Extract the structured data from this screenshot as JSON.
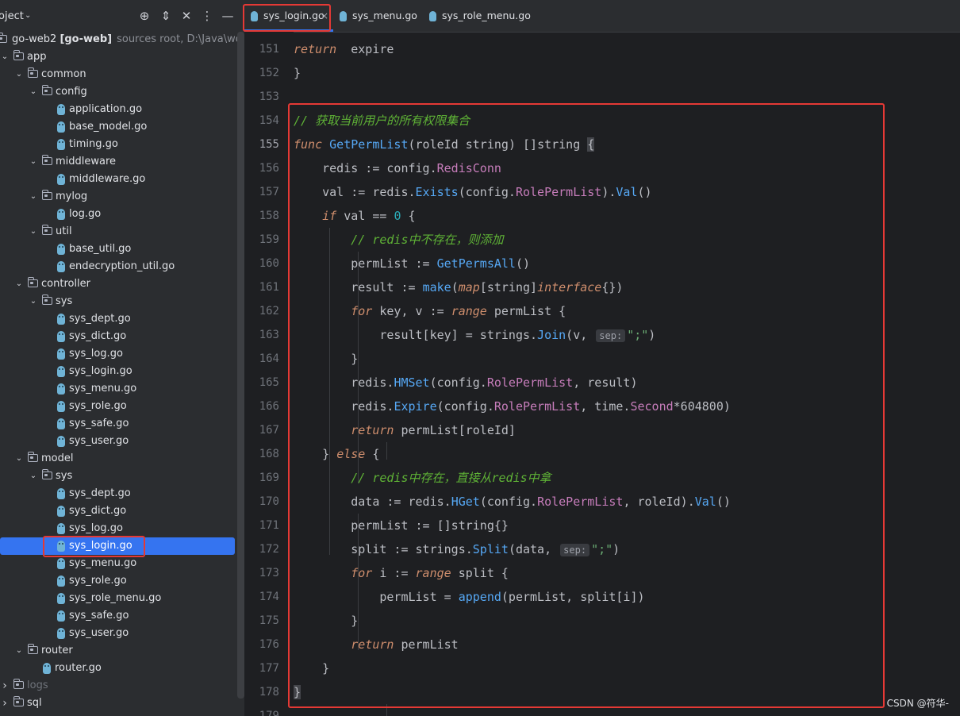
{
  "project": {
    "title": "oject",
    "root_label": "go-web2 [go-web]",
    "root_sub": "sources root,  D:\\Java\\wor",
    "tree": [
      {
        "label": "go-web2 [go-web]",
        "kind": "root",
        "depth": 0
      },
      {
        "label": "app",
        "kind": "folder",
        "depth": 0
      },
      {
        "label": "common",
        "kind": "folder",
        "depth": 1
      },
      {
        "label": "config",
        "kind": "folder",
        "depth": 2
      },
      {
        "label": "application.go",
        "kind": "go",
        "depth": 3
      },
      {
        "label": "base_model.go",
        "kind": "go",
        "depth": 3
      },
      {
        "label": "timing.go",
        "kind": "go",
        "depth": 3
      },
      {
        "label": "middleware",
        "kind": "folder",
        "depth": 2
      },
      {
        "label": "middleware.go",
        "kind": "go",
        "depth": 3
      },
      {
        "label": "mylog",
        "kind": "folder",
        "depth": 2
      },
      {
        "label": "log.go",
        "kind": "go",
        "depth": 3
      },
      {
        "label": "util",
        "kind": "folder",
        "depth": 2
      },
      {
        "label": "base_util.go",
        "kind": "go",
        "depth": 3
      },
      {
        "label": "endecryption_util.go",
        "kind": "go",
        "depth": 3
      },
      {
        "label": "controller",
        "kind": "folder",
        "depth": 1
      },
      {
        "label": "sys",
        "kind": "folder",
        "depth": 2
      },
      {
        "label": "sys_dept.go",
        "kind": "go",
        "depth": 3
      },
      {
        "label": "sys_dict.go",
        "kind": "go",
        "depth": 3
      },
      {
        "label": "sys_log.go",
        "kind": "go",
        "depth": 3
      },
      {
        "label": "sys_login.go",
        "kind": "go",
        "depth": 3
      },
      {
        "label": "sys_menu.go",
        "kind": "go",
        "depth": 3
      },
      {
        "label": "sys_role.go",
        "kind": "go",
        "depth": 3
      },
      {
        "label": "sys_safe.go",
        "kind": "go",
        "depth": 3
      },
      {
        "label": "sys_user.go",
        "kind": "go",
        "depth": 3
      },
      {
        "label": "model",
        "kind": "folder",
        "depth": 1
      },
      {
        "label": "sys",
        "kind": "folder",
        "depth": 2
      },
      {
        "label": "sys_dept.go",
        "kind": "go",
        "depth": 3
      },
      {
        "label": "sys_dict.go",
        "kind": "go",
        "depth": 3
      },
      {
        "label": "sys_log.go",
        "kind": "go",
        "depth": 3
      },
      {
        "label": "sys_login.go",
        "kind": "go",
        "depth": 3,
        "selected": true
      },
      {
        "label": "sys_menu.go",
        "kind": "go",
        "depth": 3
      },
      {
        "label": "sys_role.go",
        "kind": "go",
        "depth": 3
      },
      {
        "label": "sys_role_menu.go",
        "kind": "go",
        "depth": 3
      },
      {
        "label": "sys_safe.go",
        "kind": "go",
        "depth": 3
      },
      {
        "label": "sys_user.go",
        "kind": "go",
        "depth": 3
      },
      {
        "label": "router",
        "kind": "folder",
        "depth": 1
      },
      {
        "label": "router.go",
        "kind": "go",
        "depth": 2
      },
      {
        "label": "logs",
        "kind": "folder-collapsed",
        "depth": 0,
        "dim": true
      },
      {
        "label": "sql",
        "kind": "folder-collapsed",
        "depth": 0
      }
    ]
  },
  "tabs": [
    {
      "label": "sys_login.go",
      "active": true,
      "close": "×"
    },
    {
      "label": "sys_menu.go"
    },
    {
      "label": "sys_role_menu.go"
    }
  ],
  "line_numbers": [
    "151",
    "152",
    "153",
    "154",
    "155",
    "156",
    "157",
    "158",
    "159",
    "160",
    "161",
    "162",
    "163",
    "164",
    "165",
    "166",
    "167",
    "168",
    "169",
    "170",
    "171",
    "172",
    "173",
    "174",
    "175",
    "176",
    "177",
    "178",
    "179"
  ],
  "current_line": "155",
  "code_lines": [
    [
      [
        "kw",
        "return"
      ],
      [
        "",
        "  expire"
      ]
    ],
    [
      [
        "",
        "}"
      ]
    ],
    [],
    [
      [
        "cmt",
        "// 获取当前用户的所有权限集合"
      ]
    ],
    [
      [
        "kw",
        "func"
      ],
      [
        "",
        ""
      ],
      [
        "fn",
        " GetPermList"
      ],
      [
        "",
        "(roleId "
      ],
      [
        "type",
        "string"
      ],
      [
        "",
        ") []"
      ],
      [
        "type",
        "string"
      ],
      [
        "brace",
        " {"
      ]
    ],
    [
      [
        "",
        "    redis := config."
      ],
      [
        "field",
        "RedisConn"
      ]
    ],
    [
      [
        "",
        "    val := redis."
      ],
      [
        "fn",
        "Exists"
      ],
      [
        "",
        "(config."
      ],
      [
        "field",
        "RolePermList"
      ],
      [
        "",
        ")."
      ],
      [
        "fn",
        "Val"
      ],
      [
        "",
        "()"
      ]
    ],
    [
      [
        "kw",
        "    if"
      ],
      [
        "",
        " val == "
      ],
      [
        "num",
        "0"
      ],
      [
        "",
        " {"
      ]
    ],
    [
      [
        "cmt",
        "        // redis中不存在，则添加"
      ]
    ],
    [
      [
        "",
        "        permList := "
      ],
      [
        "fn",
        "GetPermsAll"
      ],
      [
        "",
        "()"
      ]
    ],
    [
      [
        "",
        "        result := "
      ],
      [
        "fn",
        "make"
      ],
      [
        "",
        "("
      ],
      [
        "kw",
        "map"
      ],
      [
        "",
        "[string]"
      ],
      [
        "kw",
        "interface"
      ],
      [
        "",
        "{})"
      ]
    ],
    [
      [
        "kw",
        "        for"
      ],
      [
        "",
        " key, v := "
      ],
      [
        "kw",
        "range"
      ],
      [
        "",
        " permList {"
      ]
    ],
    [
      [
        "",
        "            result[key] = strings."
      ],
      [
        "fn",
        "Join"
      ],
      [
        "",
        "(v, "
      ],
      [
        "hint",
        "sep:"
      ],
      [
        "str",
        "\";\""
      ],
      [
        "",
        ")"
      ]
    ],
    [
      [
        "",
        "        }"
      ]
    ],
    [
      [
        "",
        "        redis."
      ],
      [
        "fn",
        "HMSet"
      ],
      [
        "",
        "(config."
      ],
      [
        "field",
        "RolePermList"
      ],
      [
        "",
        ", result)"
      ]
    ],
    [
      [
        "",
        "        redis."
      ],
      [
        "fn",
        "Expire"
      ],
      [
        "",
        "(config."
      ],
      [
        "field",
        "RolePermList"
      ],
      [
        "",
        ", time."
      ],
      [
        "field",
        "Second"
      ],
      [
        "",
        "*604800)"
      ]
    ],
    [
      [
        "kw",
        "        return"
      ],
      [
        "",
        " permList[roleId]"
      ]
    ],
    [
      [
        "",
        "    } "
      ],
      [
        "kw",
        "else"
      ],
      [
        "",
        " {"
      ]
    ],
    [
      [
        "cmt",
        "        // redis中存在，直接从redis中拿"
      ]
    ],
    [
      [
        "",
        "        data := redis."
      ],
      [
        "fn",
        "HGet"
      ],
      [
        "",
        "(config."
      ],
      [
        "field",
        "RolePermList"
      ],
      [
        "",
        ", roleId)."
      ],
      [
        "fn",
        "Val"
      ],
      [
        "",
        "()"
      ]
    ],
    [
      [
        "",
        "        permList := []string{}"
      ]
    ],
    [
      [
        "",
        "        split := strings."
      ],
      [
        "fn",
        "Split"
      ],
      [
        "",
        "(data, "
      ],
      [
        "hint",
        "sep:"
      ],
      [
        "str",
        "\";\""
      ],
      [
        "",
        ")"
      ]
    ],
    [
      [
        "kw",
        "        for"
      ],
      [
        "",
        " i := "
      ],
      [
        "kw",
        "range"
      ],
      [
        "",
        " split {"
      ]
    ],
    [
      [
        "",
        "            permList = "
      ],
      [
        "fn",
        "append"
      ],
      [
        "",
        "(permList, split[i])"
      ]
    ],
    [
      [
        "",
        "        }"
      ]
    ],
    [
      [
        "kw",
        "        return"
      ],
      [
        "",
        " permList"
      ]
    ],
    [
      [
        "",
        "    }"
      ]
    ],
    [
      [
        "brace",
        "}"
      ]
    ],
    []
  ],
  "watermark": "CSDN @符华-"
}
